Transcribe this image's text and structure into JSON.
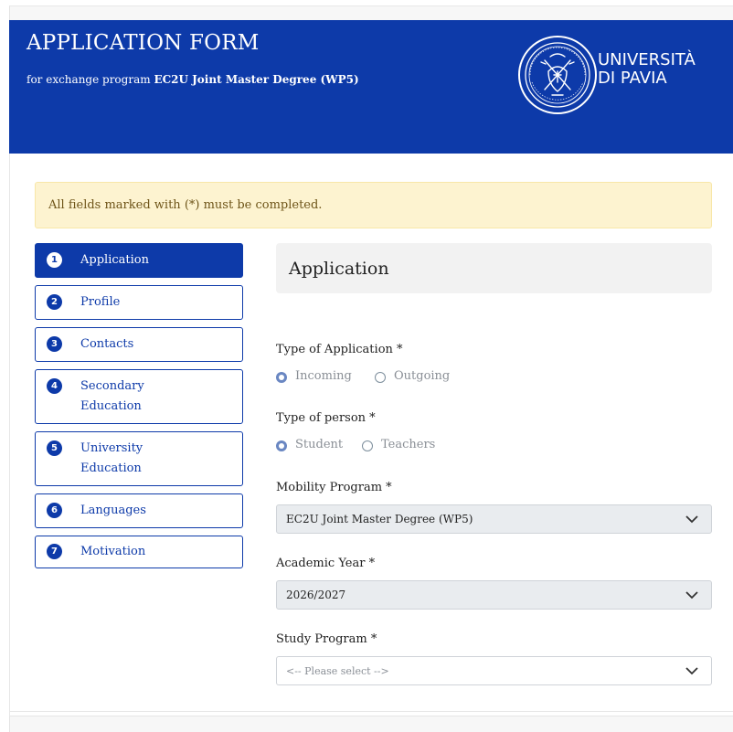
{
  "header": {
    "title": "APPLICATION FORM",
    "subtitle_prefix": "for exchange program ",
    "subtitle_program": "EC2U Joint Master Degree (WP5)",
    "university_line1": "UNIVERSITÀ",
    "university_line2": "DI PAVIA",
    "brand_color": "#0d3aa9"
  },
  "alert": {
    "text": "All fields marked with (*) must be completed."
  },
  "steps": [
    {
      "num": "1",
      "label": "Application",
      "active": true
    },
    {
      "num": "2",
      "label": "Profile"
    },
    {
      "num": "3",
      "label": "Contacts"
    },
    {
      "num": "4",
      "label": "Secondary Education"
    },
    {
      "num": "5",
      "label": "University Education"
    },
    {
      "num": "6",
      "label": "Languages"
    },
    {
      "num": "7",
      "label": "Motivation"
    }
  ],
  "section": {
    "title": "Application"
  },
  "form": {
    "type_of_application": {
      "label": "Type of Application *",
      "options": [
        "Incoming",
        "Outgoing"
      ],
      "selected": "Incoming"
    },
    "type_of_person": {
      "label": "Type of person *",
      "options": [
        "Student",
        "Teachers"
      ],
      "selected": "Student"
    },
    "mobility_program": {
      "label": "Mobility Program *",
      "value": "EC2U Joint Master Degree (WP5)"
    },
    "academic_year": {
      "label": "Academic Year *",
      "value": "2026/2027"
    },
    "study_program": {
      "label": "Study Program *",
      "placeholder": "<-- Please select -->"
    }
  }
}
